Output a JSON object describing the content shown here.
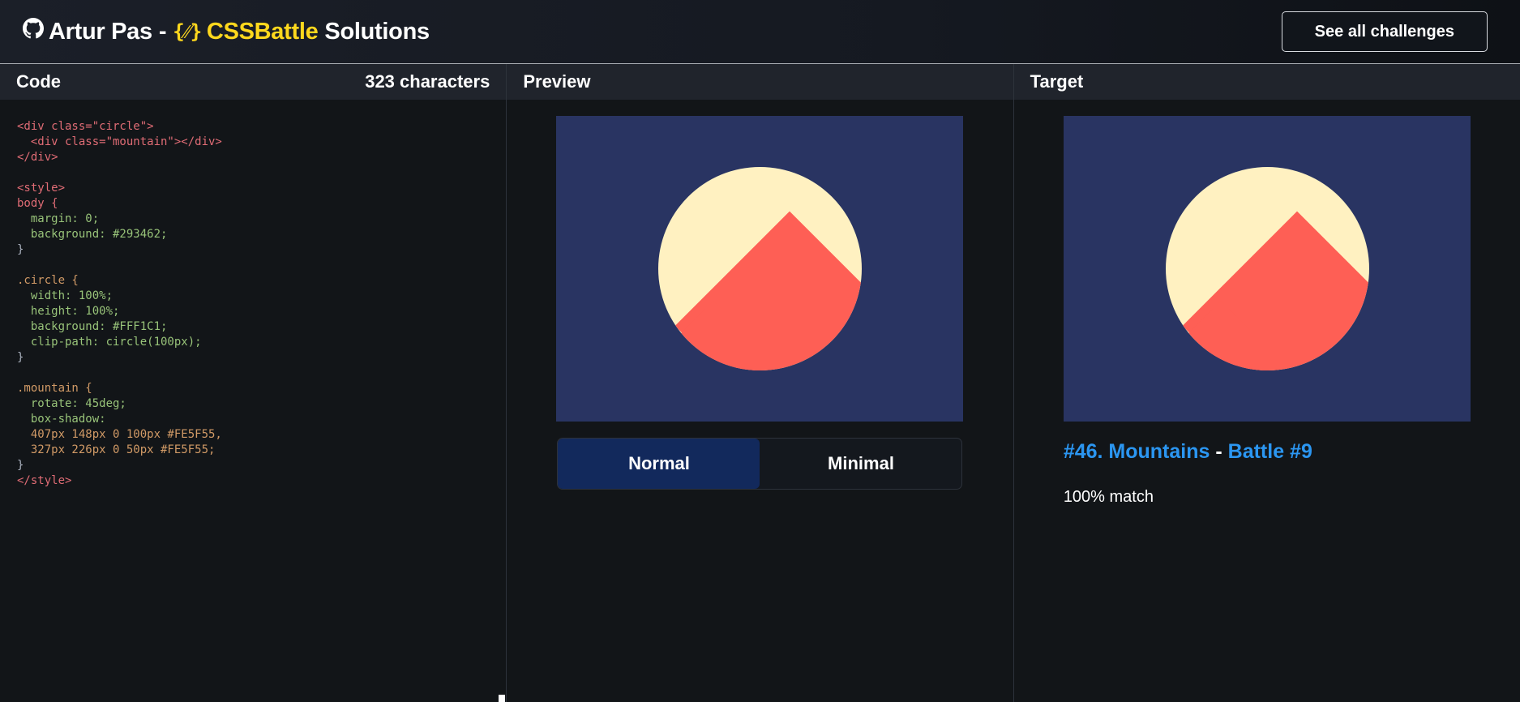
{
  "header": {
    "author": "Artur Pas",
    "separator": "-",
    "braces_icon": "{⁄⁄}",
    "site": "CSSBattle",
    "suffix": "Solutions",
    "cta_label": "See all challenges",
    "github_icon": "github-icon"
  },
  "code_panel": {
    "title": "Code",
    "char_count": "323 characters"
  },
  "preview_panel": {
    "title": "Preview",
    "toggle": {
      "normal": "Normal",
      "minimal": "Minimal",
      "selected": "Normal"
    }
  },
  "target_panel": {
    "title": "Target",
    "challenge_link": "#46. Mountains",
    "separator": "-",
    "battle_link": "Battle #9",
    "match": "100% match"
  },
  "colors": {
    "background": "#293462",
    "sun": "#FFF1C1",
    "mountain": "#FE5F55",
    "accent_link": "#2b96f1",
    "brand_yellow": "#ffd81d"
  },
  "code_lines": [
    "<div class=\"circle\">",
    "  <div class=\"mountain\"></div>",
    "</div>",
    "",
    "<style>",
    "body {",
    "  margin: 0;",
    "  background: #293462;",
    "}",
    "",
    ".circle {",
    "  width: 100%;",
    "  height: 100%;",
    "  background: #FFF1C1;",
    "  clip-path: circle(100px);",
    "}",
    "",
    ".mountain {",
    "  rotate: 45deg;",
    "  box-shadow:",
    "  407px 148px 0 100px #FE5F55,",
    "  327px 226px 0 50px #FE5F55;",
    "}",
    "</style>"
  ]
}
